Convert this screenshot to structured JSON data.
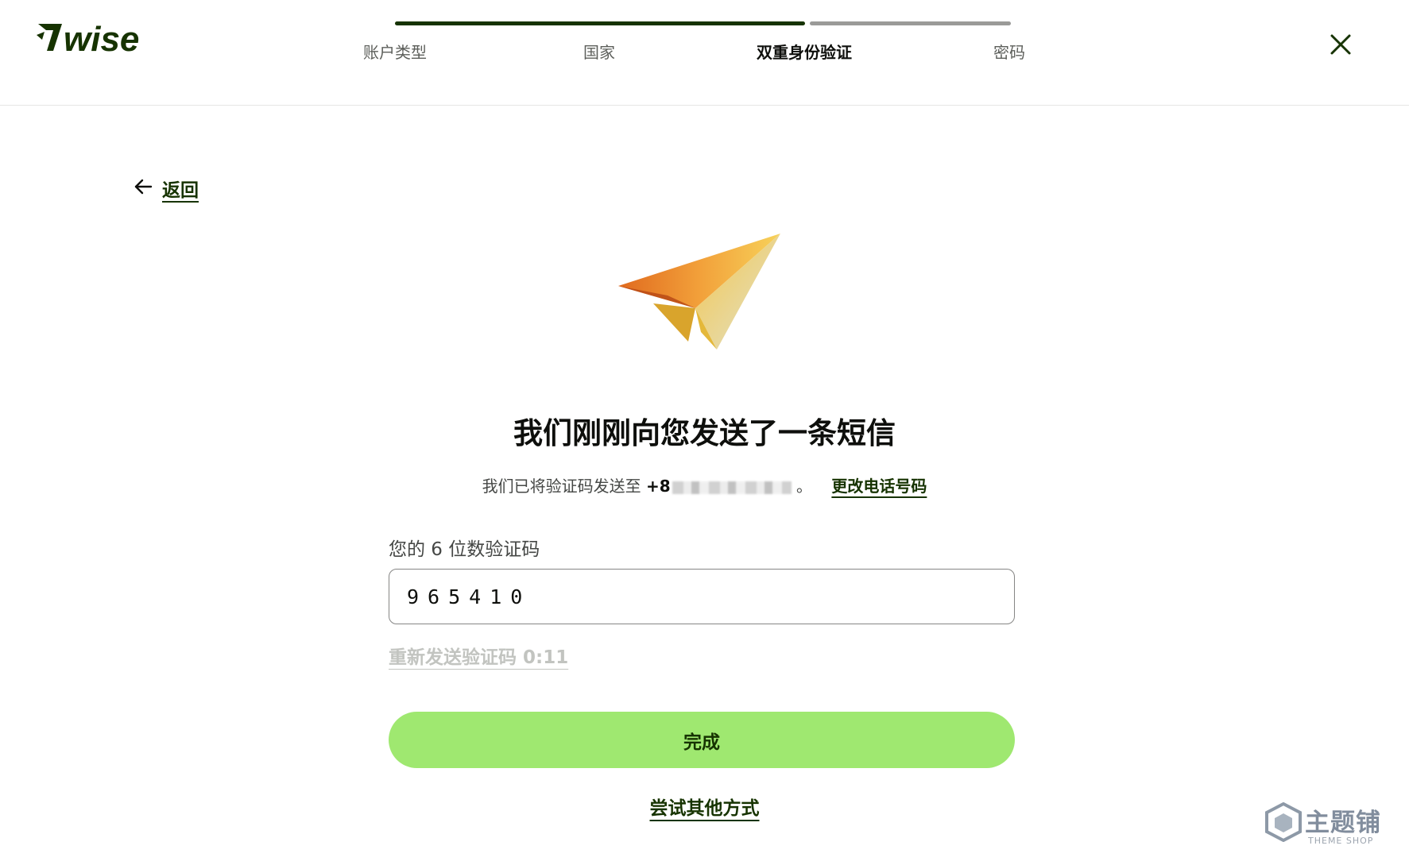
{
  "brand": {
    "logo_text": "7WISE",
    "color": "#163300",
    "accent": "#9fe870"
  },
  "steps": [
    {
      "label": "账户类型",
      "state": "done"
    },
    {
      "label": "国家",
      "state": "done"
    },
    {
      "label": "双重身份验证",
      "state": "active"
    },
    {
      "label": "密码",
      "state": "todo"
    }
  ],
  "progress": {
    "completed_fraction": 0.67
  },
  "back": {
    "label": "返回",
    "icon": "arrow-left-icon"
  },
  "main": {
    "title": "我们刚刚向您发送了一条短信",
    "sent_text": "我们已将验证码发送至",
    "phone_visible": "+8",
    "sent_suffix": "。",
    "change_phone_link": "更改电话号码"
  },
  "code_field": {
    "label": "您的 6 位数验证码",
    "value": "965410"
  },
  "resend": {
    "label": "重新发送验证码 0:11"
  },
  "done_button": {
    "label": "完成"
  },
  "other_method_link": {
    "label": "尝试其他方式"
  },
  "watermark": {
    "cn_text": "主题铺",
    "en_text": "THEME SHOP"
  }
}
